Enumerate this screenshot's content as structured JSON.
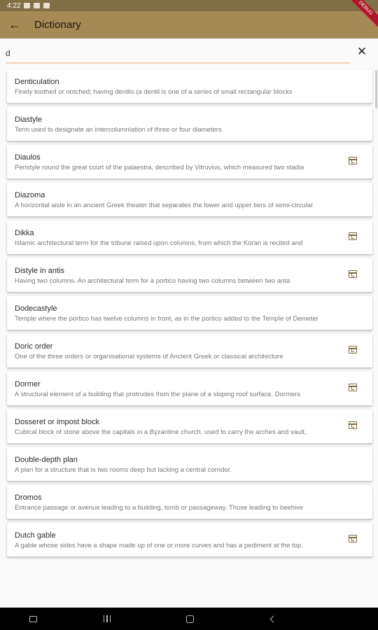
{
  "status_bar": {
    "time": "4:22"
  },
  "app_bar": {
    "title": "Dictionary",
    "debug_banner": "DEBUG"
  },
  "search": {
    "value": "d"
  },
  "entries": [
    {
      "term": "Denticulation",
      "definition": "Finely toothed or notched; having dentils (a dentil is one of a series of small rectangular blocks",
      "bookmarked": false
    },
    {
      "term": "Diastyle",
      "definition": "Term used to designate an intercolumniation of three or four diameters",
      "bookmarked": false
    },
    {
      "term": "Diaulos",
      "definition": "Peristyle round the great court of the palaestra, described by Vitruvius, which measured two stadia",
      "bookmarked": true
    },
    {
      "term": "Diazoma",
      "definition": "A horizontal aisle in an ancient Greek theater that separates the lower and upper tiers of semi-circular",
      "bookmarked": false
    },
    {
      "term": "Dikka",
      "definition": "Islamic architectural term for the tribune raised upon columns, from which the Koran is recited and",
      "bookmarked": true
    },
    {
      "term": "Distyle in antis",
      "definition": "Having two columns. An architectural term for a portico having two columns between two anta",
      "bookmarked": true
    },
    {
      "term": "Dodecastyle",
      "definition": "Temple where the portico has twelve columns in front, as in the portico added to the Temple of Demeter",
      "bookmarked": false
    },
    {
      "term": "Doric order",
      "definition": "One of the three orders or organisational systems of Ancient Greek or classical architecture",
      "bookmarked": true
    },
    {
      "term": "Dormer",
      "definition": "A structural element of a building that protrudes from the plane of a sloping roof surface. Dormers",
      "bookmarked": true
    },
    {
      "term": "Dosseret or impost block",
      "definition": "Cubical block of stone above the capitals in a Byzantine church, used to carry the arches and vault,",
      "bookmarked": true
    },
    {
      "term": "Double-depth plan",
      "definition": "A plan for a structure that is two rooms deep but lacking a central corridor.",
      "bookmarked": false
    },
    {
      "term": "Dromos",
      "definition": "Entrance passage or avenue leading to a building, tomb or passageway. Those leading to beehive",
      "bookmarked": false
    },
    {
      "term": "Dutch gable",
      "definition": "A gable whose sides have a shape made up of one or more curves and has a pediment at the top.",
      "bookmarked": true
    }
  ],
  "icons": {
    "back": "arrow-left-icon",
    "clear": "close-icon",
    "entry_action": "bookmark-calendar-icon"
  },
  "colors": {
    "app_bar": "#a68a55",
    "status_bar": "#826f46",
    "search_underline": "#f2d5b9",
    "icon": "#7d6a40"
  }
}
